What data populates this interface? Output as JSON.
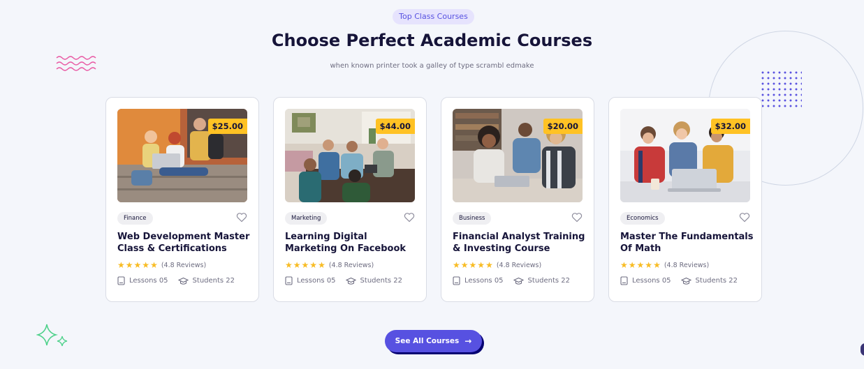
{
  "section": {
    "badge": "Top Class Courses",
    "title": "Choose Perfect Academic Courses",
    "subtitle": "when known printer took a galley of type scrambl edmake"
  },
  "courses": [
    {
      "price": "$25.00",
      "category": "Finance",
      "title": "Web Development Master Class & Certifications",
      "reviews": "(4.8 Reviews)",
      "lessons": "Lessons 05",
      "students": "Students 22"
    },
    {
      "price": "$44.00",
      "category": "Marketing",
      "title": "Learning Digital Marketing On Facebook",
      "reviews": "(4.8 Reviews)",
      "lessons": "Lessons 05",
      "students": "Students 22"
    },
    {
      "price": "$20.00",
      "category": "Business",
      "title": "Financial Analyst Training & Investing Course",
      "reviews": "(4.8 Reviews)",
      "lessons": "Lessons 05",
      "students": "Students 22"
    },
    {
      "price": "$32.00",
      "category": "Economics",
      "title": "Master The Fundamentals Of Math",
      "reviews": "(4.8 Reviews)",
      "lessons": "Lessons 05",
      "students": "Students 22"
    }
  ],
  "cta": {
    "label": "See All Courses",
    "arrow": "→"
  },
  "colors": {
    "accent": "#5751e1",
    "price": "#ffc224",
    "star": "#f8bc24",
    "title": "#161439"
  }
}
